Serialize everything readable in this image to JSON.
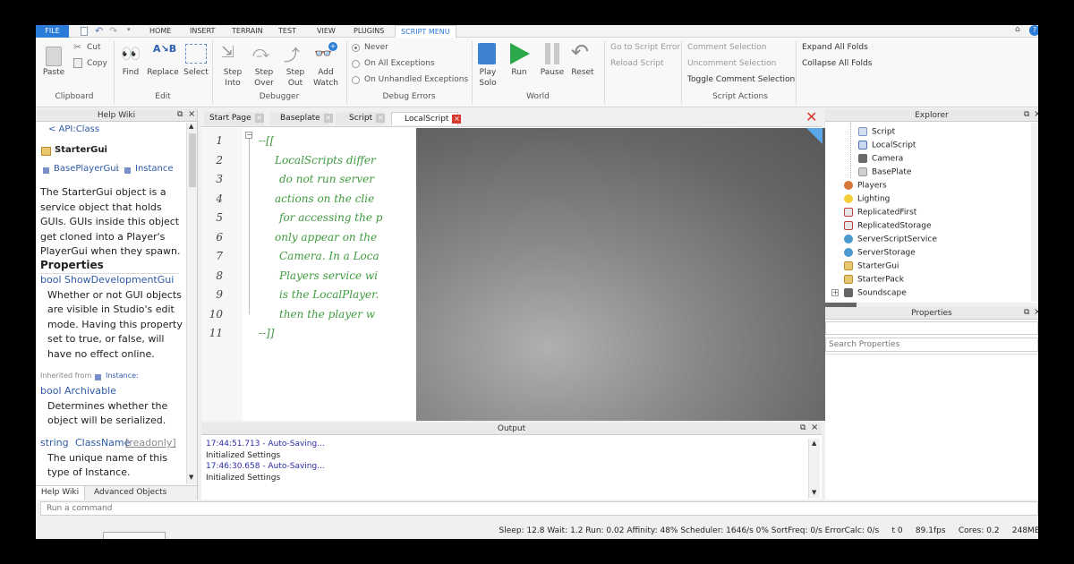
{
  "ribbon_tabs": [
    "FILE",
    "HOME",
    "INSERT",
    "TERRAIN",
    "TEST",
    "VIEW",
    "PLUGINS",
    "SCRIPT MENU"
  ],
  "clipboard": {
    "paste": "Paste",
    "cut": "Cut",
    "copy": "Copy",
    "group": "Clipboard"
  },
  "edit": {
    "find": "Find",
    "replace": "Replace",
    "select": "Select",
    "group": "Edit"
  },
  "debugger": {
    "step_into": "Step Into",
    "step_over": "Step Over",
    "step_out": "Step Out",
    "add_watch": "Add Watch",
    "group": "Debugger"
  },
  "debug_errors": {
    "never": "Never",
    "on_all": "On All Exceptions",
    "on_unhandled": "On Unhandled Exceptions",
    "group": "Debug Errors",
    "selected": "Never"
  },
  "world": {
    "play_solo": "Play Solo",
    "run": "Run",
    "pause": "Pause",
    "reset": "Reset",
    "group": "World"
  },
  "script_tools": {
    "goto_error": "Go to Script Error",
    "reload": "Reload Script"
  },
  "script_actions": {
    "comment": "Comment Selection",
    "uncomment": "Uncomment Selection",
    "toggle": "Toggle Comment Selection",
    "group": "Script Actions"
  },
  "folds": {
    "expand": "Expand All Folds",
    "collapse": "Collapse All Folds"
  },
  "help_wiki": {
    "title": "Help Wiki",
    "breadcrumb": "< API:Class",
    "class_name": "StarterGui",
    "class_suffix": ":",
    "inherits": [
      "BasePlayerGui",
      ":",
      "Instance"
    ],
    "description": [
      "The StarterGui object is a",
      "service object that holds",
      "GUIs. GUIs inside this object",
      "get cloned into a Player's",
      "PlayerGui when they spawn."
    ],
    "properties_heading": "Properties",
    "prop1_type": "bool",
    "prop1_name": "ShowDevelopmentGui",
    "prop1_desc": [
      "Whether or not GUI objects",
      "are visible in Studio's edit",
      "mode. Having this property",
      "set to true, or false, will",
      "have no effect online."
    ],
    "inherited_from": "Inherited from",
    "inherited_class": "Instance:",
    "prop2_type": "bool",
    "prop2_name": "Archivable",
    "prop2_desc": [
      "Determines whether the",
      "object will be serialized."
    ],
    "prop3_type": "string",
    "prop3_name": "ClassName",
    "prop3_tag": "[readonly]",
    "prop3_desc": [
      "The unique name of this",
      "type of Instance."
    ],
    "bottom_tabs": [
      "Help Wiki",
      "Advanced Objects"
    ]
  },
  "editor": {
    "tabs": [
      "Start Page",
      "Baseplate",
      "Script",
      "LocalScript"
    ],
    "line_numbers": [
      "1",
      "2",
      "3",
      "4",
      "5",
      "6",
      "7",
      "8",
      "9",
      "10",
      "11"
    ],
    "lines": [
      "--[[",
      "LocalScripts differ",
      "do not run server",
      "actions on the clie",
      "for accessing the p",
      "only appear on the",
      "Camera. In a Loca",
      "Players service wi",
      "is the LocalPlayer.",
      "then the player w",
      "--]]"
    ]
  },
  "output": {
    "title": "Output",
    "lines": [
      {
        "text": "17:44:51.713 - Auto-Saving...",
        "color": "#2b2ba8"
      },
      {
        "text": "Initialized Settings",
        "color": "#222222"
      },
      {
        "text": "17:46:30.658 - Auto-Saving...",
        "color": "#2b2ba8"
      },
      {
        "text": "Initialized Settings",
        "color": "#222222"
      }
    ]
  },
  "explorer": {
    "title": "Explorer",
    "items": [
      {
        "label": "Script",
        "icon": "script-icon"
      },
      {
        "label": "LocalScript",
        "icon": "local-script-icon"
      },
      {
        "label": "Camera",
        "icon": "camera-icon"
      },
      {
        "label": "BasePlate",
        "icon": "part-icon"
      },
      {
        "label": "Players",
        "icon": "players-icon"
      },
      {
        "label": "Lighting",
        "icon": "lighting-icon"
      },
      {
        "label": "ReplicatedFirst",
        "icon": "replicated-first-icon"
      },
      {
        "label": "ReplicatedStorage",
        "icon": "replicated-storage-icon"
      },
      {
        "label": "ServerScriptService",
        "icon": "server-script-service-icon"
      },
      {
        "label": "ServerStorage",
        "icon": "server-storage-icon"
      },
      {
        "label": "StarterGui",
        "icon": "starter-gui-icon"
      },
      {
        "label": "StarterPack",
        "icon": "starter-pack-icon"
      },
      {
        "label": "Soundscape",
        "icon": "soundscape-icon"
      }
    ]
  },
  "properties": {
    "title": "Properties",
    "search_placeholder": "Search Properties"
  },
  "command_bar": {
    "placeholder": "Run a command"
  },
  "status_bar": "Sleep: 12.8 Wait: 1.2 Run: 0.02 Affinity: 48% Scheduler: 1646/s 0% SortFreq: 0/s ErrorCalc: 0/s     t 0     89.1fps     Cores: 0.2     248MB",
  "colors": {
    "accent": "#2b7bd8",
    "code_green": "#3f9a3f",
    "run_green": "#2aa84a",
    "close_red": "#d9382f"
  }
}
